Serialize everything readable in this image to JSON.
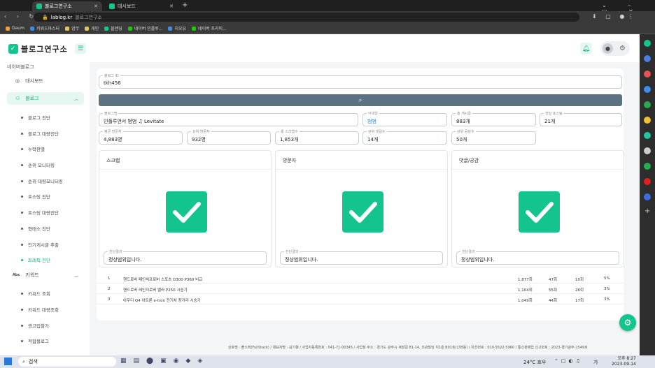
{
  "browser": {
    "tabs": [
      {
        "label": "블로그연구소"
      },
      {
        "label": "대시보드"
      }
    ],
    "new_tab": "+",
    "url_host": "lablog.kr",
    "url_title": "블로그연구소",
    "bookmarks": [
      "Daum",
      "키워드마스터",
      "업무",
      "개인",
      "블랜딩",
      "네이버 인플루...",
      "지오유",
      "네이버 프리미..."
    ]
  },
  "app": {
    "logo": "블로그연구소",
    "menu_icon": "hamburger-icon",
    "accent_color": "#14c48f"
  },
  "sidebar": {
    "section_title": "네이버블로그",
    "dashboard": "대시보드",
    "blog": "블로그",
    "blog_items": [
      "블로그 진단",
      "블로그 대량진단",
      "누락판별",
      "순위 모니터링",
      "순위 대량모니터링",
      "포스팅 진단",
      "포스팅 대량진단",
      "형태소 진단",
      "인기게시글 추출",
      "트래픽 진단"
    ],
    "keyword_prefix": "Abc",
    "keyword": "키워드",
    "keyword_items": [
      "키워드 조회",
      "키워드 대량조회",
      "광고입찰가",
      "적합블로그"
    ]
  },
  "form": {
    "blog_id": {
      "label": "블로그 ID",
      "value": "tkh456"
    },
    "blog_name": {
      "label": "블로그명",
      "value": "인플루언서 범범 ♫ Levitate"
    },
    "nickname": {
      "label": "닉네임",
      "value": "범범"
    },
    "total_posts": {
      "label": "총 게시글",
      "value": "883개"
    },
    "daily_posts": {
      "label": "한달 포스팅",
      "value": "21개"
    },
    "avg_visitors": {
      "label": "평균 방문자",
      "value": "4,883명"
    },
    "top_visitors": {
      "label": "상위 방문자",
      "value": "932명"
    },
    "total_scraps": {
      "label": "총 스크랩수",
      "value": "1,853개"
    },
    "top_comments": {
      "label": "상위 댓글수",
      "value": "14개"
    },
    "top_likes": {
      "label": "상위 공감수",
      "value": "50개"
    }
  },
  "panels": [
    {
      "title": "스크랩",
      "result_label": "진단결과",
      "result": "정상범위입니다."
    },
    {
      "title": "방문자",
      "result_label": "진단결과",
      "result": "정상범위입니다."
    },
    {
      "title": "댓글/공감",
      "result_label": "진단결과",
      "result": "정상범위입니다."
    }
  ],
  "table": [
    {
      "no": "1",
      "title": "핸드로버 페인치프로버 스포츠 D300 P360 비교",
      "views": "1,877회",
      "a": "47회",
      "b": "10회",
      "pct": "5%"
    },
    {
      "no": "2",
      "title": "핸드로버 레인지로버 벨라 P250 시승기",
      "views": "1,104회",
      "a": "55회",
      "b": "26회",
      "pct": "3%"
    },
    {
      "no": "3",
      "title": "아우디 Q4 이트론 e-tron 전기차 장거리 시승기",
      "views": "1,049회",
      "a": "44회",
      "b": "17회",
      "pct": "3%"
    }
  ],
  "footer": "상호명 : 풀스택(FullStack) / 대표자명 : 김기향 / 사업자등록번호 : 541-71-00345 / 사업장 주소 : 경기도 광주시 새말길 81-14, 조광빌딩 지1층 B01호(신현동) / 유선번호 : 010-5522-5960 / 통신판매업 신고번호 : 2023-경기광주-1549호",
  "taskbar": {
    "search": "검색",
    "weather": "24°C 흐우",
    "time": "오후 8:27",
    "date": "2023-09-14",
    "lang": "가"
  }
}
